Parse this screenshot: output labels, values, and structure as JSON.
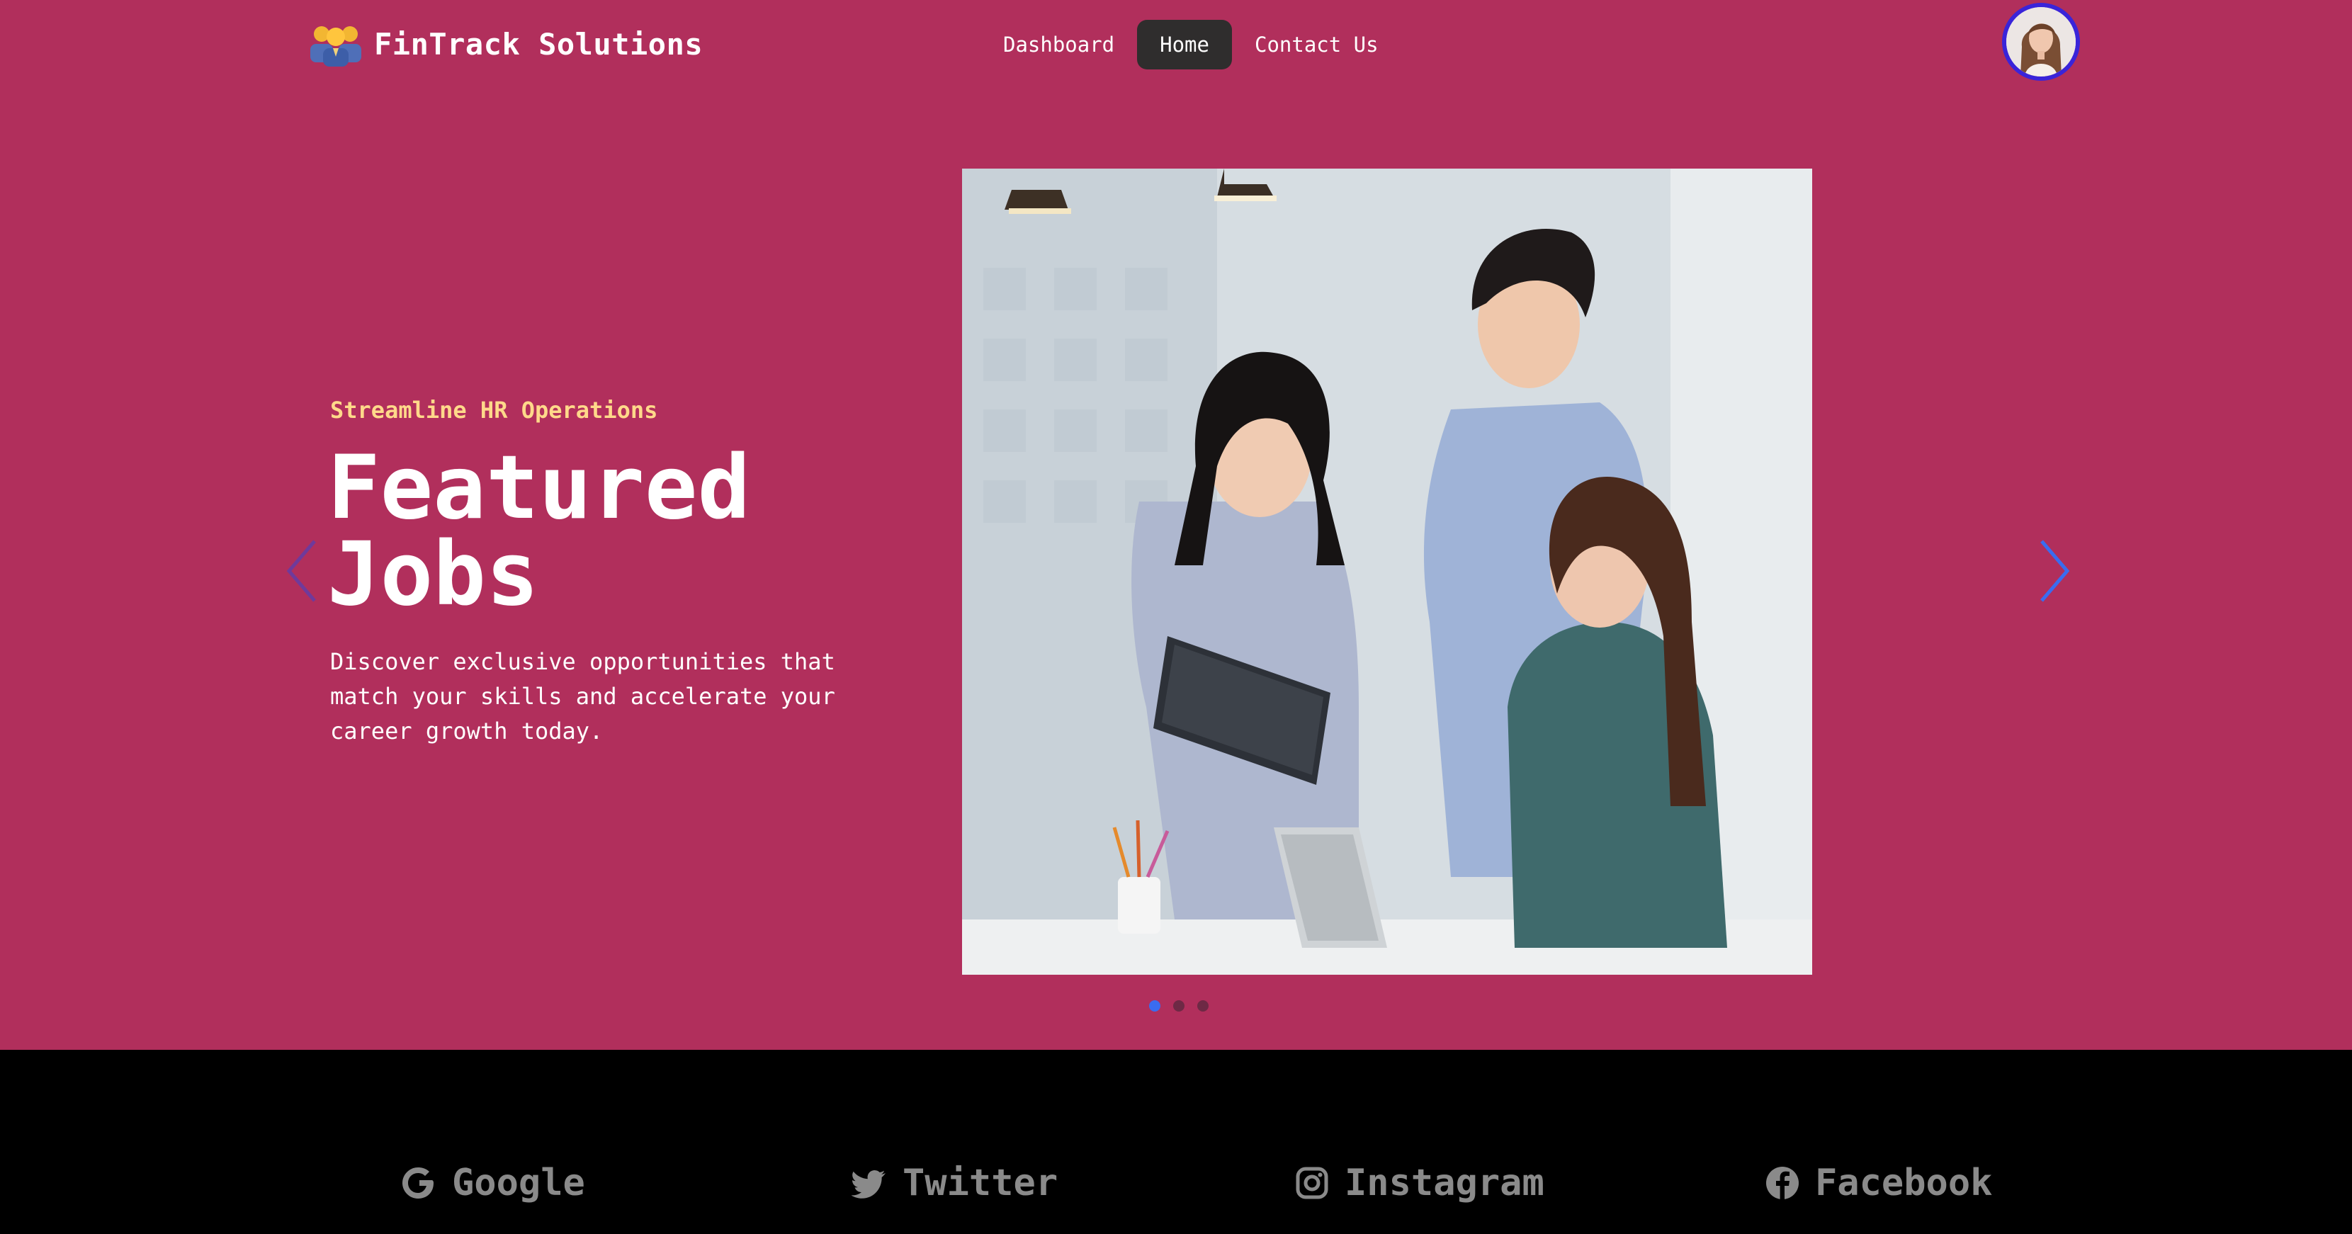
{
  "header": {
    "brand_title": "FinTrack Solutions",
    "brand_logo_icon": "team-people-icon",
    "nav": [
      {
        "label": "Dashboard",
        "active": false
      },
      {
        "label": "Home",
        "active": true
      },
      {
        "label": "Contact Us",
        "active": false
      }
    ],
    "avatar_icon": "user-avatar"
  },
  "hero": {
    "eyebrow": "Streamline HR Operations",
    "headline": "Featured Jobs",
    "description": "Discover exclusive opportunities that match your skills and accelerate your career growth today.",
    "slide_image": "office-team-photo",
    "prev_icon": "chevron-left-icon",
    "next_icon": "chevron-right-icon",
    "slides_count": 3,
    "active_slide": 1
  },
  "footer": {
    "links": [
      {
        "label": "Google",
        "icon": "google-icon"
      },
      {
        "label": "Twitter",
        "icon": "twitter-icon"
      },
      {
        "label": "Instagram",
        "icon": "instagram-icon"
      },
      {
        "label": "Facebook",
        "icon": "facebook-icon"
      }
    ]
  },
  "colors": {
    "hero_bg": "#b12f5c",
    "accent_yellow": "#ffd98a",
    "nav_active_bg": "#2f2d2d",
    "carousel_accent": "#3a6cf0",
    "footer_bg": "#000000",
    "footer_text": "#8a8a8a"
  }
}
